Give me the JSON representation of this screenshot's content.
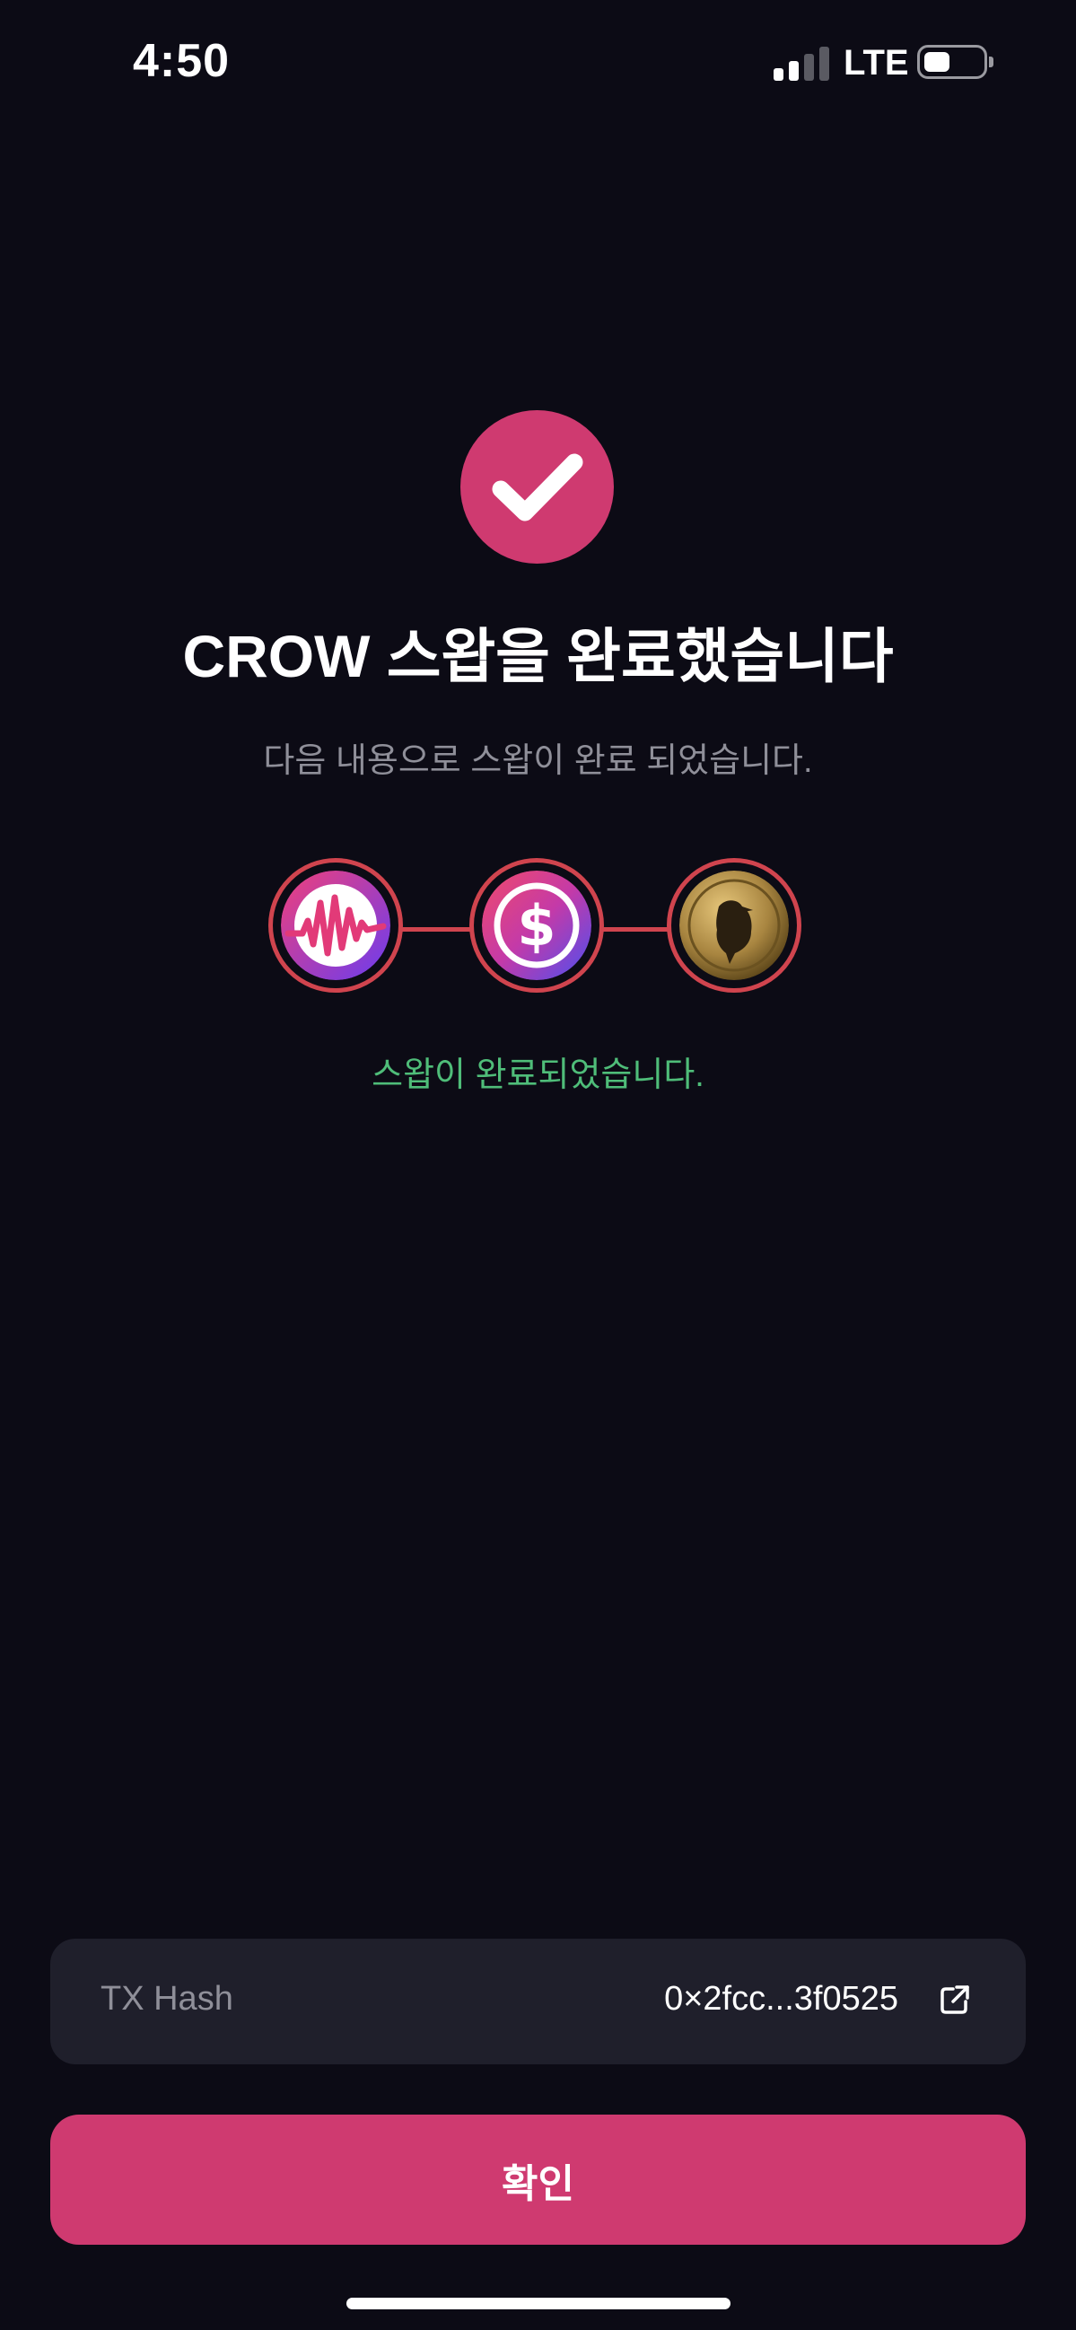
{
  "status_bar": {
    "time": "4:50",
    "network": "LTE",
    "signal_bars_active": 2,
    "signal_bars_total": 4,
    "battery_level": 0.45
  },
  "result": {
    "title": "CROW 스왑을 완료했습니다",
    "subtitle": "다음 내용으로 스왑이 완료 되었습니다.",
    "status_message": "스왑이 완료되었습니다.",
    "status_icon": "check-icon"
  },
  "swap_route": [
    {
      "icon": "wave-token-icon"
    },
    {
      "icon": "usd-stablecoin-icon"
    },
    {
      "icon": "crow-coin-icon"
    }
  ],
  "transaction": {
    "label": "TX Hash",
    "value": "0×2fcc...3f0525",
    "link_icon": "external-link-icon"
  },
  "confirm_button": {
    "label": "확인"
  },
  "colors": {
    "background": "#0c0b15",
    "accent": "#cf3a70",
    "route_ring": "#d0444e",
    "success_text": "#4fbd79",
    "muted_text": "#8f8f99",
    "card": "#1f1f2b"
  }
}
